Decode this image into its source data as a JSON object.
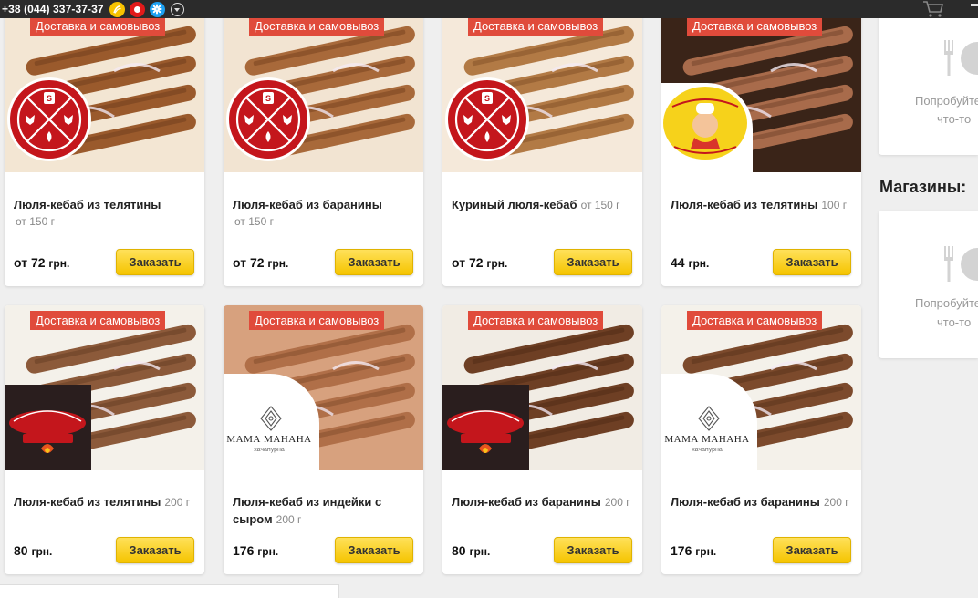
{
  "header": {
    "phone": "+38 (044) 337-37-37"
  },
  "badge_label": "Доставка и самовывоз",
  "order_label": "Заказать",
  "products": [
    {
      "name": "Люля-кебаб из телятины",
      "weight": "от 150 г",
      "price": "от 72",
      "currency": "грн.",
      "logo": "restaurant-s-logo"
    },
    {
      "name": "Люля-кебаб из баранины",
      "weight": "от 150 г",
      "price": "от 72",
      "currency": "грн.",
      "logo": "restaurant-s-logo"
    },
    {
      "name": "Куриный люля-кебаб",
      "weight": "от 150 г",
      "price": "от 72",
      "currency": "грн.",
      "logo": "restaurant-s-logo"
    },
    {
      "name": "Люля-кебаб из телятины",
      "weight": "100 г",
      "price": "44",
      "currency": "грн.",
      "logo": "chef-cartoon-logo"
    },
    {
      "name": "Люля-кебаб из телятины",
      "weight": "200 г",
      "price": "80",
      "currency": "грн.",
      "logo": "dostavka-vkusa-logo"
    },
    {
      "name": "Люля-кебаб из индейки с сыром",
      "weight": "200 г",
      "price": "176",
      "currency": "грн.",
      "logo": "mama-manana-logo"
    },
    {
      "name": "Люля-кебаб из баранины",
      "weight": "200 г",
      "price": "80",
      "currency": "грн.",
      "logo": "dostavka-vkusa-logo"
    },
    {
      "name": "Люля-кебаб из баранины",
      "weight": "200 г",
      "price": "176",
      "currency": "грн.",
      "logo": "mama-manana-logo"
    }
  ],
  "logos": {
    "mama_manana": "МАМА МАНАНА",
    "mama_manana_sub": "хачапурна"
  },
  "sidebar": {
    "empty_text_line1": "Попробуйте",
    "empty_text_line2": "что-то",
    "shops_heading": "Магазины:",
    "empty2_line1": "Попробуйте",
    "empty2_line2": "что-то"
  },
  "colors": {
    "badge": "#e04b3b",
    "button": "#f5c400",
    "logo_red": "#c4161c",
    "topbar": "#2b2b2b"
  }
}
